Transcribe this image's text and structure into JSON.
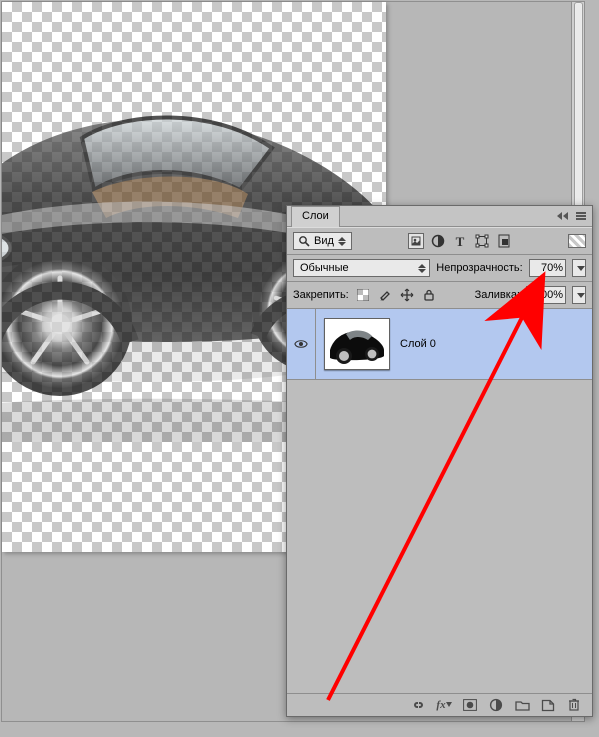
{
  "panel": {
    "title": "Слои",
    "search_label": "Вид",
    "blend_mode": "Обычные",
    "opacity_label": "Непрозрачность:",
    "opacity_value": "70%",
    "lock_label": "Закрепить:",
    "fill_label": "Заливка:",
    "fill_value": "100%",
    "layer": {
      "name": "Слой 0"
    },
    "footer_fx": "fx"
  },
  "icons": {
    "search": "search-icon",
    "filter1": "image-filter-icon",
    "filter2": "adjust-icon",
    "text": "text-icon",
    "shape": "transform-icon",
    "smart": "smart-object-icon",
    "eye": "eye-icon",
    "link": "link-icon",
    "mask": "mask-icon",
    "half": "circle-half-icon",
    "folder": "folder-icon",
    "new": "new-layer-icon",
    "trash": "trash-icon"
  }
}
